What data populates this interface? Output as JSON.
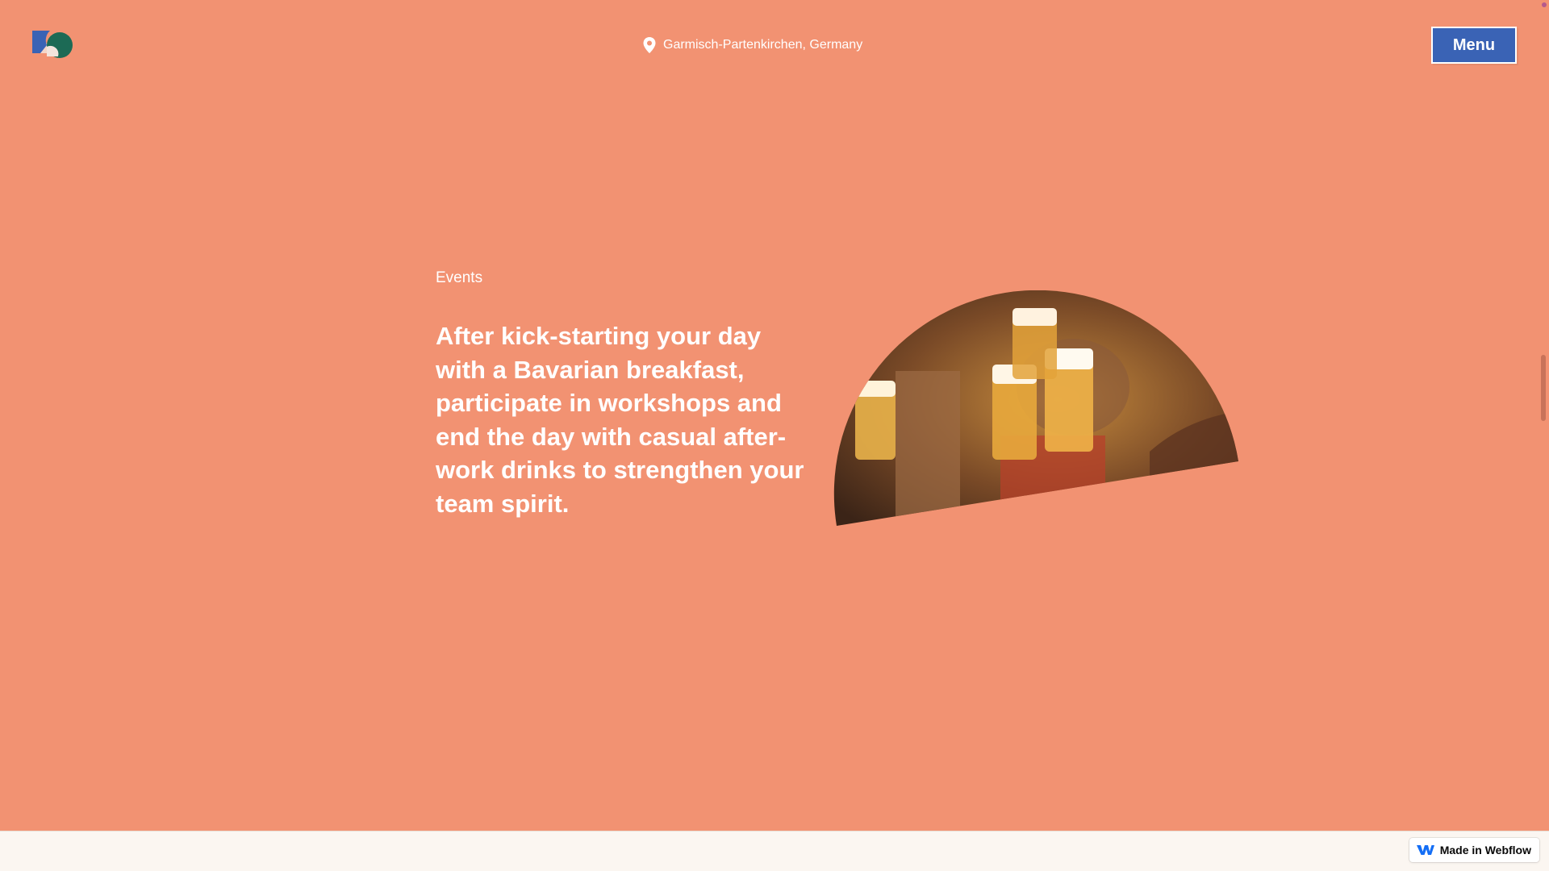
{
  "header": {
    "logo_name": "brand-logo",
    "location": "Garmisch-Partenkirchen, Germany",
    "menu_label": "Menu"
  },
  "main": {
    "section_label": "Events",
    "lead_text": "After kick-starting your day with a Bavarian breakfast, participate in workshops and end the day with casual after-work drinks to strengthen your team spirit."
  },
  "footer": {
    "badge_label": "Made in Webflow"
  },
  "colors": {
    "background": "#f29272",
    "menu_button": "#3a63b5",
    "text": "#ffffff",
    "logo_blue": "#3a63b5",
    "logo_green": "#1c6a55"
  },
  "icons": {
    "location": "map-pin-icon",
    "webflow": "webflow-icon"
  }
}
